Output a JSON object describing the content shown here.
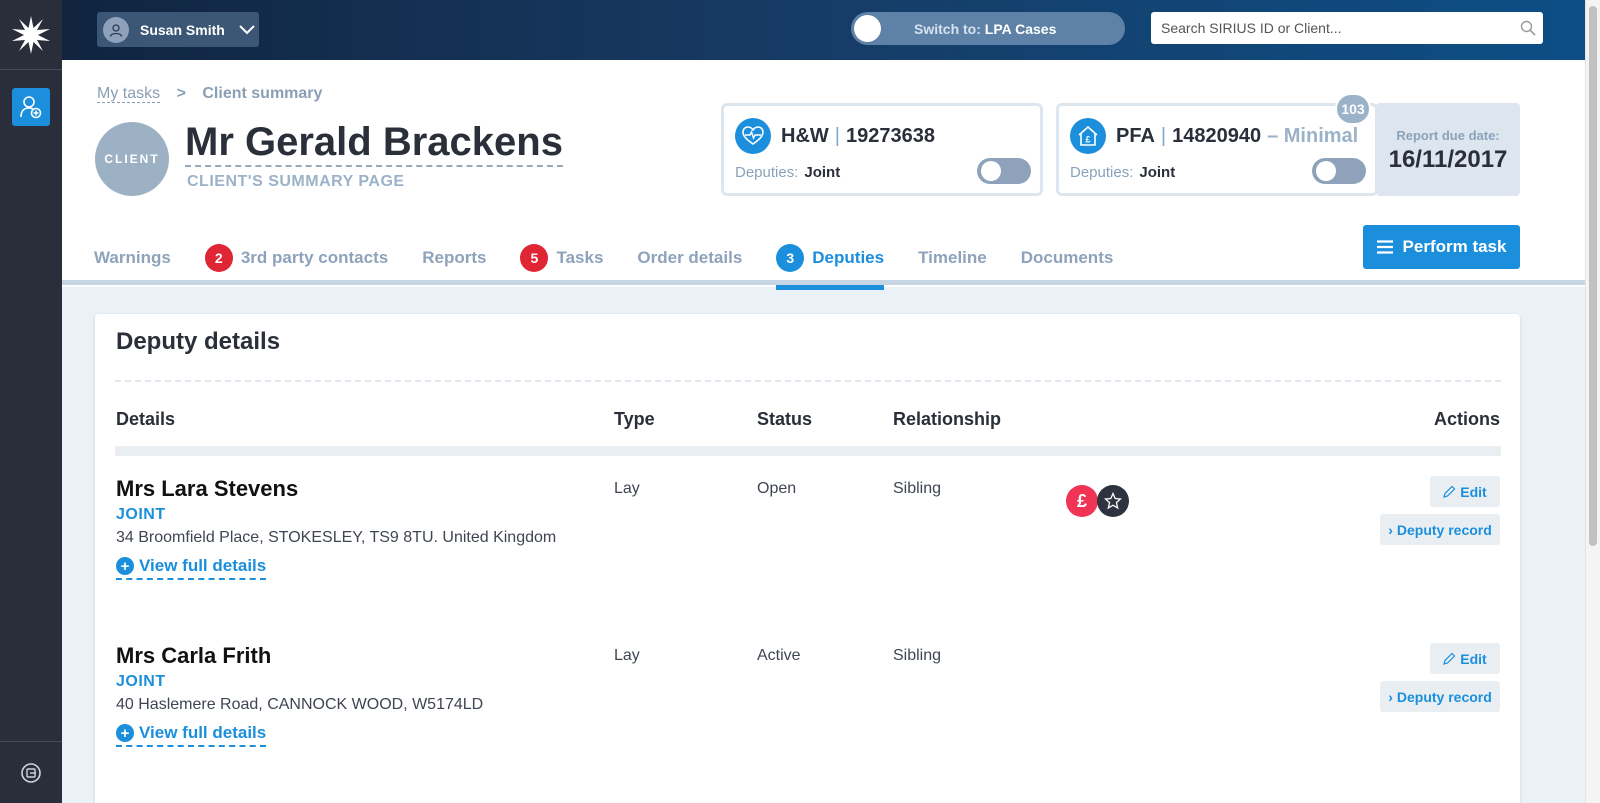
{
  "app": {
    "colors": {
      "accent": "#1b8fdc",
      "warning_badge": "#e02535",
      "rail": "#2a2d3a"
    }
  },
  "topbar": {
    "user_name": "Susan Smith",
    "switch_prefix": "Switch to:",
    "switch_target": "LPA Cases",
    "search_placeholder": "Search SIRIUS ID or Client..."
  },
  "breadcrumb": {
    "parent": "My tasks",
    "separator": ">",
    "current": "Client summary"
  },
  "client": {
    "badge": "CLIENT",
    "name": "Mr Gerald Brackens",
    "subtitle": "CLIENT'S SUMMARY PAGE"
  },
  "orders": [
    {
      "type": "H&W",
      "number": "19273638",
      "suffix": "",
      "deputies_label": "Deputies:",
      "deputies_value": "Joint",
      "icon": "heart-pulse-icon"
    },
    {
      "type": "PFA",
      "number": "14820940",
      "suffix": "– Minimal",
      "deputies_label": "Deputies:",
      "deputies_value": "Joint",
      "icon": "house-pound-icon",
      "badge": "103"
    }
  ],
  "report": {
    "label": "Report due date:",
    "date": "16/11/2017"
  },
  "tabs": [
    {
      "label": "Warnings",
      "badge": ""
    },
    {
      "label": "3rd party contacts",
      "badge": "2"
    },
    {
      "label": "Reports",
      "badge": ""
    },
    {
      "label": "Tasks",
      "badge": "5"
    },
    {
      "label": "Order details",
      "badge": ""
    },
    {
      "label": "Deputies",
      "badge": "3",
      "active": true
    },
    {
      "label": "Timeline",
      "badge": ""
    },
    {
      "label": "Documents",
      "badge": ""
    }
  ],
  "perform_task": "Perform task",
  "deputy_details": {
    "title": "Deputy details",
    "columns": {
      "details": "Details",
      "type": "Type",
      "status": "Status",
      "relationship": "Relationship",
      "actions": "Actions"
    },
    "rows": [
      {
        "name": "Mrs Lara Stevens",
        "tag": "JOINT",
        "address": "34 Broomfield Place, STOKESLEY, TS9 8TU. United Kingdom",
        "view": "View full details",
        "type": "Lay",
        "status": "Open",
        "relationship": "Sibling",
        "icons": [
          "pound-icon",
          "star-icon"
        ],
        "pound_glyph": "£",
        "edit": "Edit",
        "record": "Deputy record"
      },
      {
        "name": "Mrs Carla Frith",
        "tag": "JOINT",
        "address": "40 Haslemere Road, CANNOCK WOOD, W5174LD",
        "view": "View full details",
        "type": "Lay",
        "status": "Active",
        "relationship": "Sibling",
        "icons": [],
        "edit": "Edit",
        "record": "Deputy record"
      }
    ]
  }
}
